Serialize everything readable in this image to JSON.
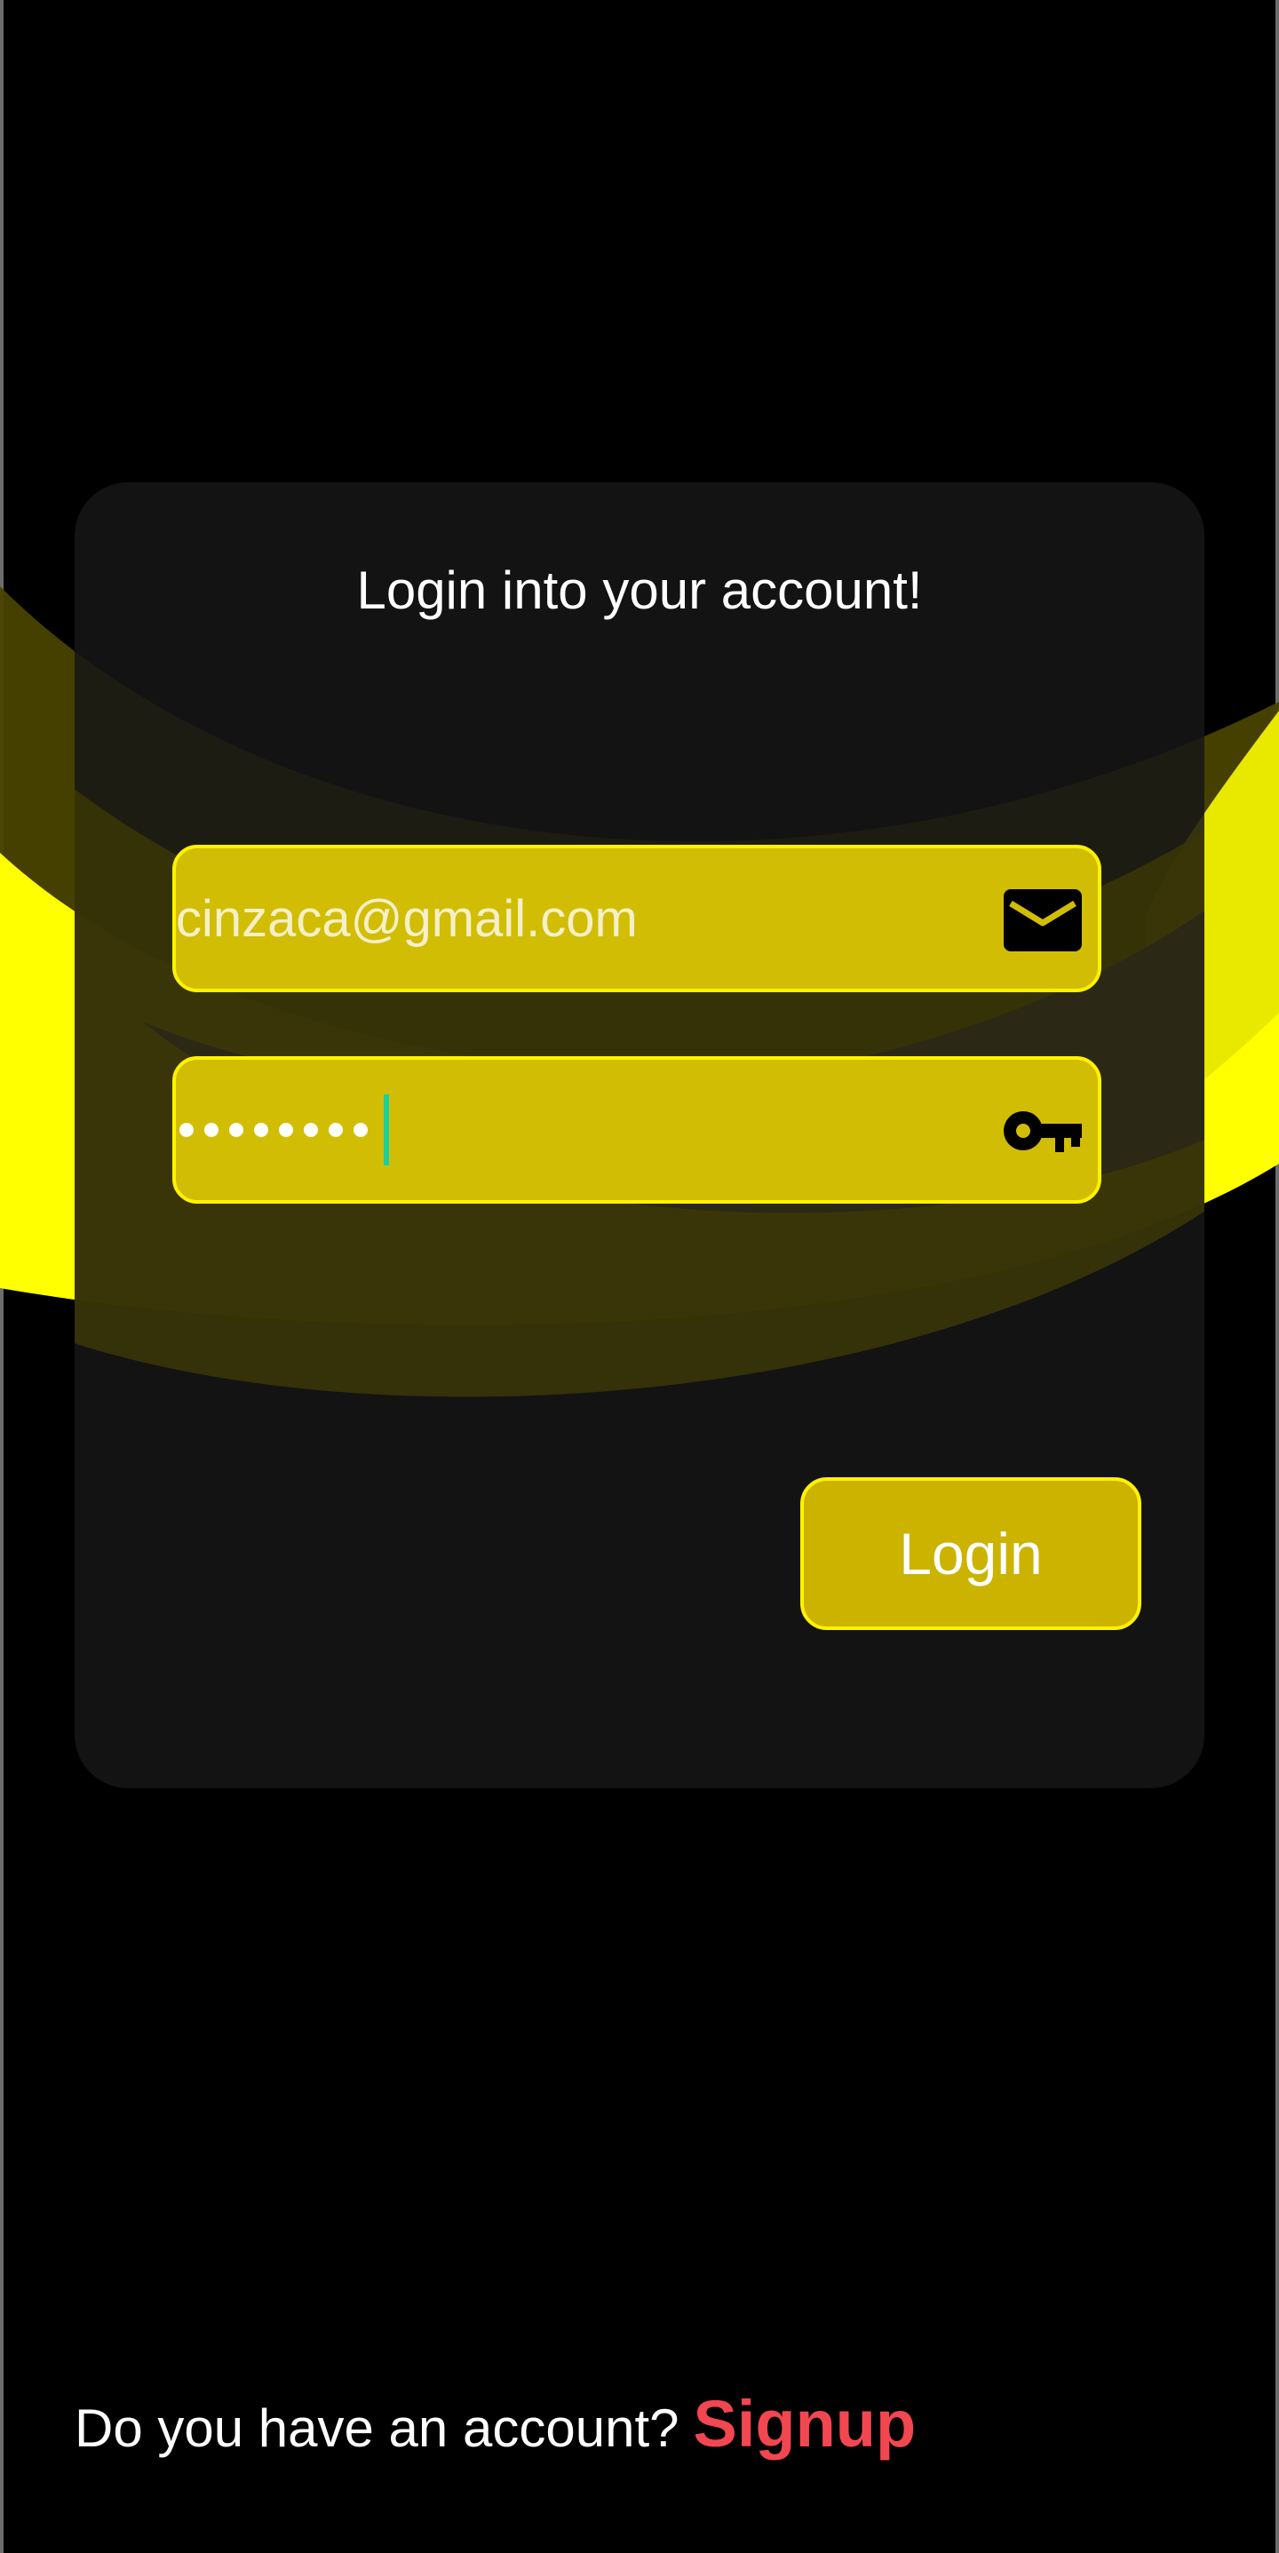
{
  "login_card": {
    "title": "Login into your account!",
    "email_field": {
      "value": "cinzaca@gmail.com",
      "icon": "envelope-icon"
    },
    "password_field": {
      "masked_length": 8,
      "icon": "key-icon"
    },
    "login_label": "Login"
  },
  "footer": {
    "question": "Do you have an account?",
    "signup_label": "Signup"
  },
  "colors": {
    "background": "#000000",
    "card": "#161616",
    "field_fill": "#d2bd05",
    "field_border": "#fff200",
    "button_fill": "#ccb300",
    "link": "#f24651",
    "caret": "#1fcf9a"
  }
}
